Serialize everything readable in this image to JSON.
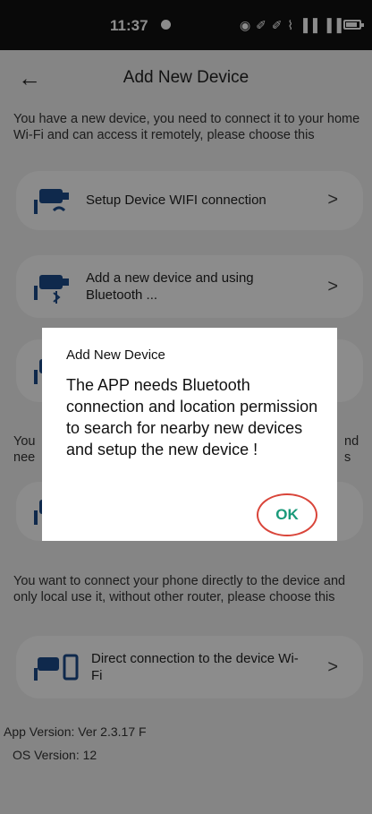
{
  "status": {
    "time": "11:37",
    "icons": "◉ ✐ ✐ ⌇ ▐▐ ▐▐"
  },
  "header": {
    "title": "Add New Device"
  },
  "section1": {
    "text": "You have a new device, you need to connect it to your home Wi-Fi and can access it remotely, please choose this"
  },
  "cards": [
    {
      "label": "Setup Device WIFI connection"
    },
    {
      "label": "Add a new device and using Bluetooth ..."
    },
    {
      "label": ""
    },
    {
      "label": ""
    }
  ],
  "section_partial": {
    "left": "You\nnee",
    "right": "nd\ns"
  },
  "section3": {
    "text": "You want to connect your phone directly to the device and only local use it, without other router, please choose this"
  },
  "direct_card": {
    "label": "Direct connection to the device Wi-Fi"
  },
  "footer": {
    "app_version": "App Version: Ver 2.3.17 F",
    "os_version": "OS Version: 12"
  },
  "dialog": {
    "title": "Add New Device",
    "message": "The APP needs Bluetooth connection and location permission to search for nearby new devices and setup the new device !",
    "ok_label": "OK"
  },
  "chevron": ">",
  "back": "←",
  "colors": {
    "accent": "#1a9a7a",
    "ok_circle": "#d9453a",
    "icon_blue": "#1c4c8a"
  }
}
